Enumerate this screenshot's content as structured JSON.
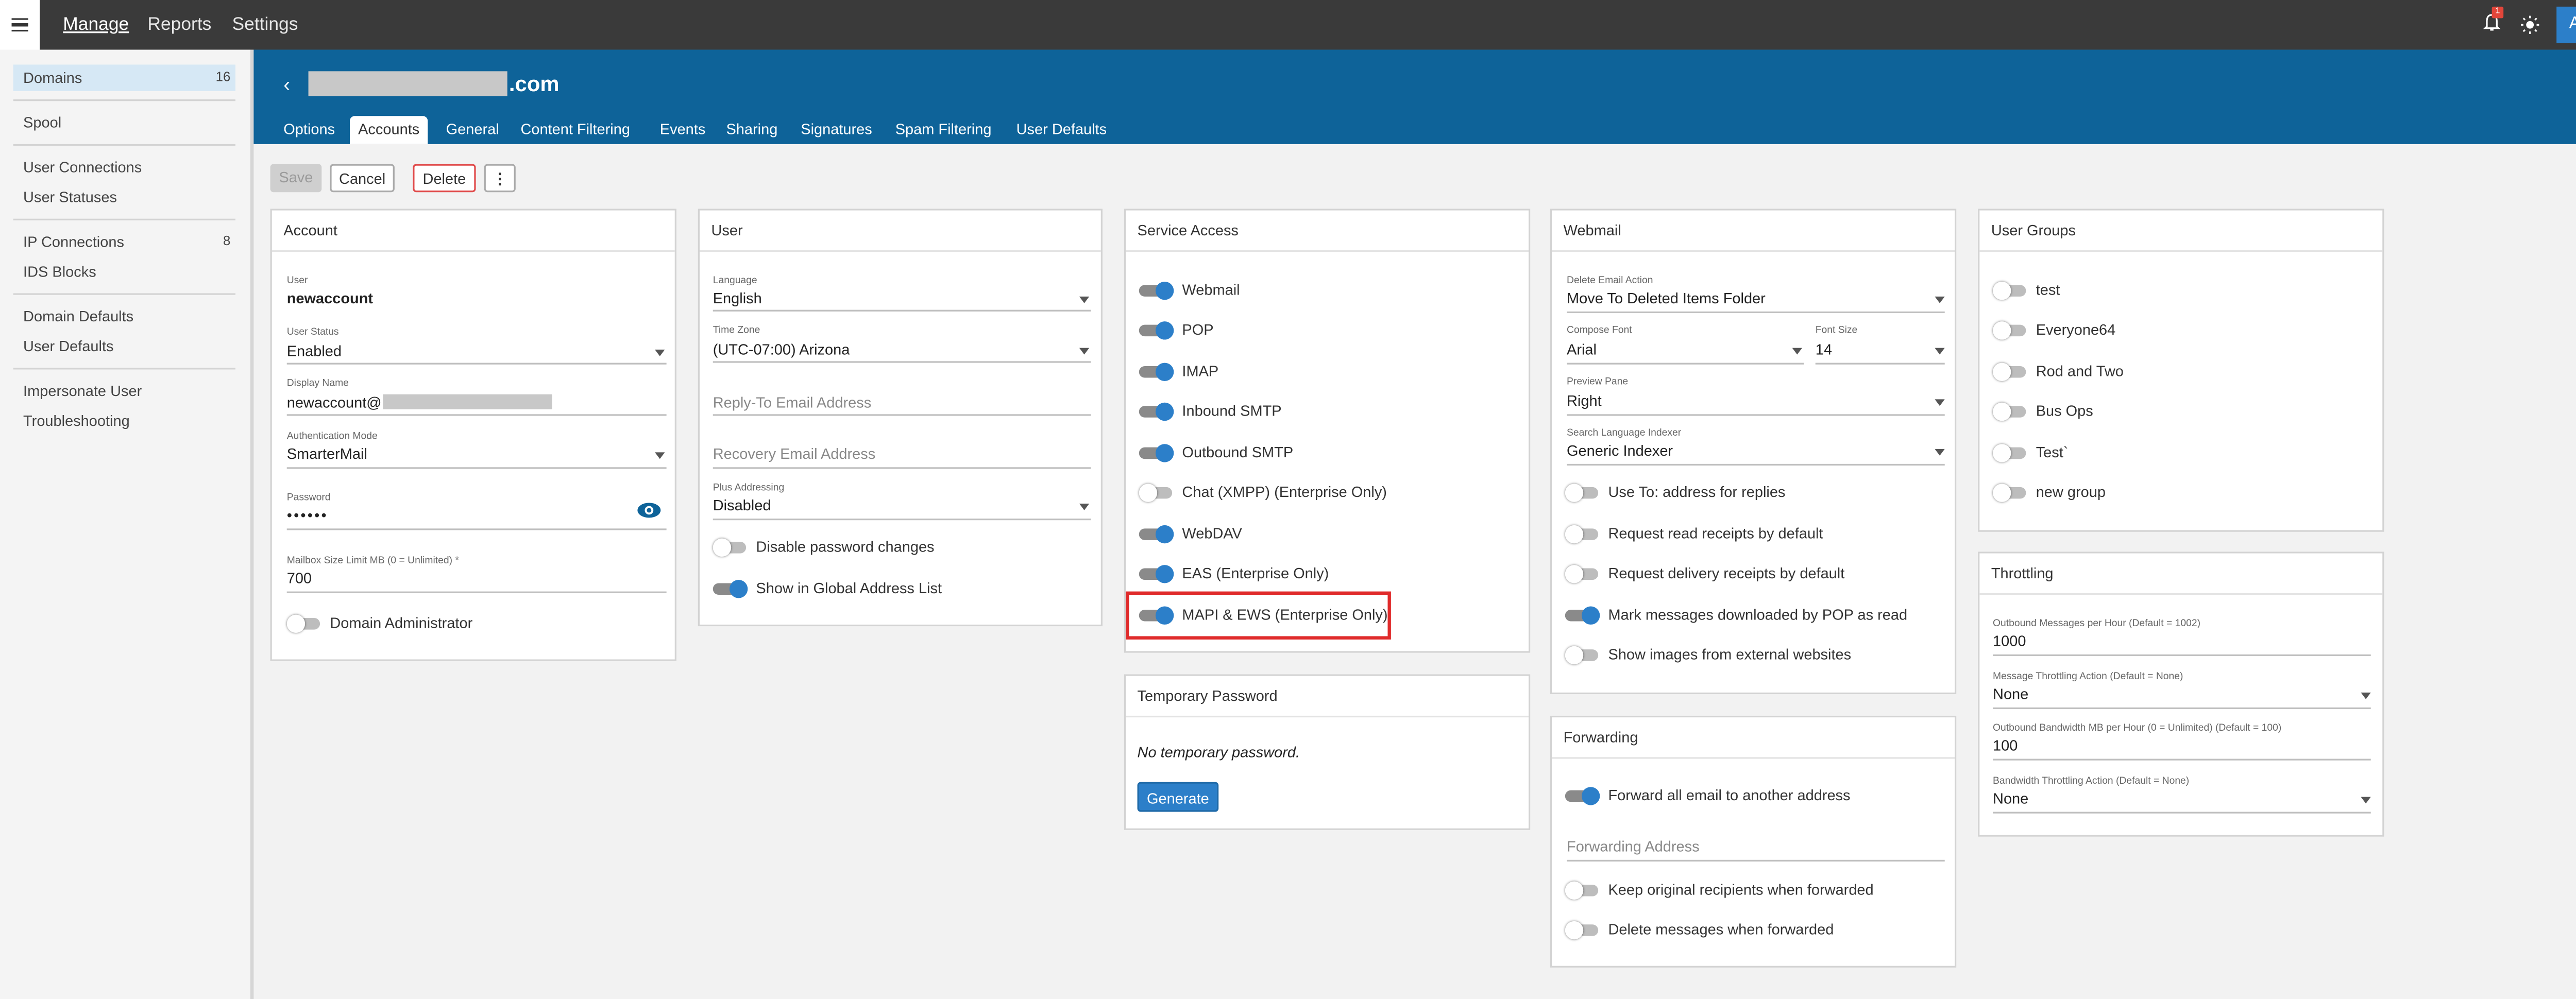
{
  "colors": {
    "accent": "#0e6399",
    "primary_button": "#2c7fc9",
    "topbar": "#3a3a3a",
    "highlight": "#e02b2b",
    "toggle_on": "#2c7fc9"
  },
  "topbar": {
    "menu_icon": "hamburger-icon",
    "nav": [
      {
        "label": "Manage"
      },
      {
        "label": "Reports"
      },
      {
        "label": "Settings"
      }
    ],
    "notification_count": "1",
    "user_initial": "A"
  },
  "sidebar": {
    "items": [
      {
        "label": "Domains",
        "count": "16"
      },
      {
        "label": "Spool",
        "count": ""
      },
      {
        "label": "User Connections",
        "count": ""
      },
      {
        "label": "User Statuses",
        "count": ""
      },
      {
        "label": "IP Connections",
        "count": "8"
      },
      {
        "label": "IDS Blocks",
        "count": ""
      },
      {
        "label": "Domain Defaults",
        "count": ""
      },
      {
        "label": "User Defaults",
        "count": ""
      },
      {
        "label": "Impersonate User",
        "count": ""
      },
      {
        "label": "Troubleshooting",
        "count": ""
      }
    ]
  },
  "header": {
    "domain_suffix": ".com",
    "tabs": [
      "Options",
      "Accounts",
      "General",
      "Content Filtering",
      "Events",
      "Sharing",
      "Signatures",
      "Spam Filtering",
      "User Defaults"
    ],
    "active_tab": "Accounts"
  },
  "toolbar": {
    "save": "Save",
    "cancel": "Cancel",
    "delete": "Delete",
    "more": "⋮"
  },
  "account": {
    "title": "Account",
    "user_label": "User",
    "user_value": "newaccount",
    "status_label": "User Status",
    "status_value": "Enabled",
    "display_label": "Display Name",
    "display_value": "newaccount@",
    "auth_label": "Authentication Mode",
    "auth_value": "SmarterMail",
    "password_label": "Password",
    "password_value": "••••••",
    "mailbox_label": "Mailbox Size Limit MB (0 = Unlimited) *",
    "mailbox_value": "700",
    "domain_admin_label": "Domain Administrator",
    "domain_admin_on": false
  },
  "user": {
    "title": "User",
    "language_label": "Language",
    "language_value": "English",
    "timezone_label": "Time Zone",
    "timezone_value": "(UTC-07:00) Arizona",
    "reply_to_placeholder": "Reply-To Email Address",
    "recovery_placeholder": "Recovery Email Address",
    "plus_label": "Plus Addressing",
    "plus_value": "Disabled",
    "toggles": [
      {
        "label": "Disable password changes",
        "on": false
      },
      {
        "label": "Show in Global Address List",
        "on": true
      }
    ]
  },
  "service_access": {
    "title": "Service Access",
    "toggles": [
      {
        "label": "Webmail",
        "on": true
      },
      {
        "label": "POP",
        "on": true
      },
      {
        "label": "IMAP",
        "on": true
      },
      {
        "label": "Inbound SMTP",
        "on": true
      },
      {
        "label": "Outbound SMTP",
        "on": true
      },
      {
        "label": "Chat (XMPP) (Enterprise Only)",
        "on": false
      },
      {
        "label": "WebDAV",
        "on": true
      },
      {
        "label": "EAS (Enterprise Only)",
        "on": true
      },
      {
        "label": "MAPI & EWS (Enterprise Only)",
        "on": true
      }
    ],
    "highlighted": "MAPI & EWS (Enterprise Only)"
  },
  "temporary_password": {
    "title": "Temporary Password",
    "message": "No temporary password.",
    "button": "Generate"
  },
  "webmail": {
    "title": "Webmail",
    "delete_action_label": "Delete Email Action",
    "delete_action_value": "Move To Deleted Items Folder",
    "compose_font_label": "Compose Font",
    "compose_font_value": "Arial",
    "font_size_label": "Font Size",
    "font_size_value": "14",
    "preview_label": "Preview Pane",
    "preview_value": "Right",
    "indexer_label": "Search Language Indexer",
    "indexer_value": "Generic Indexer",
    "toggles": [
      {
        "label": "Use To: address for replies",
        "on": false
      },
      {
        "label": "Request read receipts by default",
        "on": false
      },
      {
        "label": "Request delivery receipts by default",
        "on": false
      },
      {
        "label": "Mark messages downloaded by POP as read",
        "on": true
      },
      {
        "label": "Show images from external websites",
        "on": false
      }
    ]
  },
  "forwarding": {
    "title": "Forwarding",
    "forward_all_label": "Forward all email to another address",
    "forward_all_on": true,
    "address_placeholder": "Forwarding Address",
    "toggles": [
      {
        "label": "Keep original recipients when forwarded",
        "on": false
      },
      {
        "label": "Delete messages when forwarded",
        "on": false
      }
    ]
  },
  "user_groups": {
    "title": "User Groups",
    "toggles": [
      {
        "label": "test",
        "on": false
      },
      {
        "label": "Everyone64",
        "on": false
      },
      {
        "label": "Rod and Two",
        "on": false
      },
      {
        "label": "Bus Ops",
        "on": false
      },
      {
        "label": "Test`",
        "on": false
      },
      {
        "label": "new group",
        "on": false
      }
    ]
  },
  "throttling": {
    "title": "Throttling",
    "outbound_label": "Outbound Messages per Hour (Default = 1002)",
    "outbound_value": "1000",
    "msg_action_label": "Message Throttling Action (Default = None)",
    "msg_action_value": "None",
    "bandwidth_label": "Outbound Bandwidth MB per Hour (0 = Unlimited) (Default = 100)",
    "bandwidth_value": "100",
    "bw_action_label": "Bandwidth Throttling Action (Default = None)",
    "bw_action_value": "None"
  }
}
